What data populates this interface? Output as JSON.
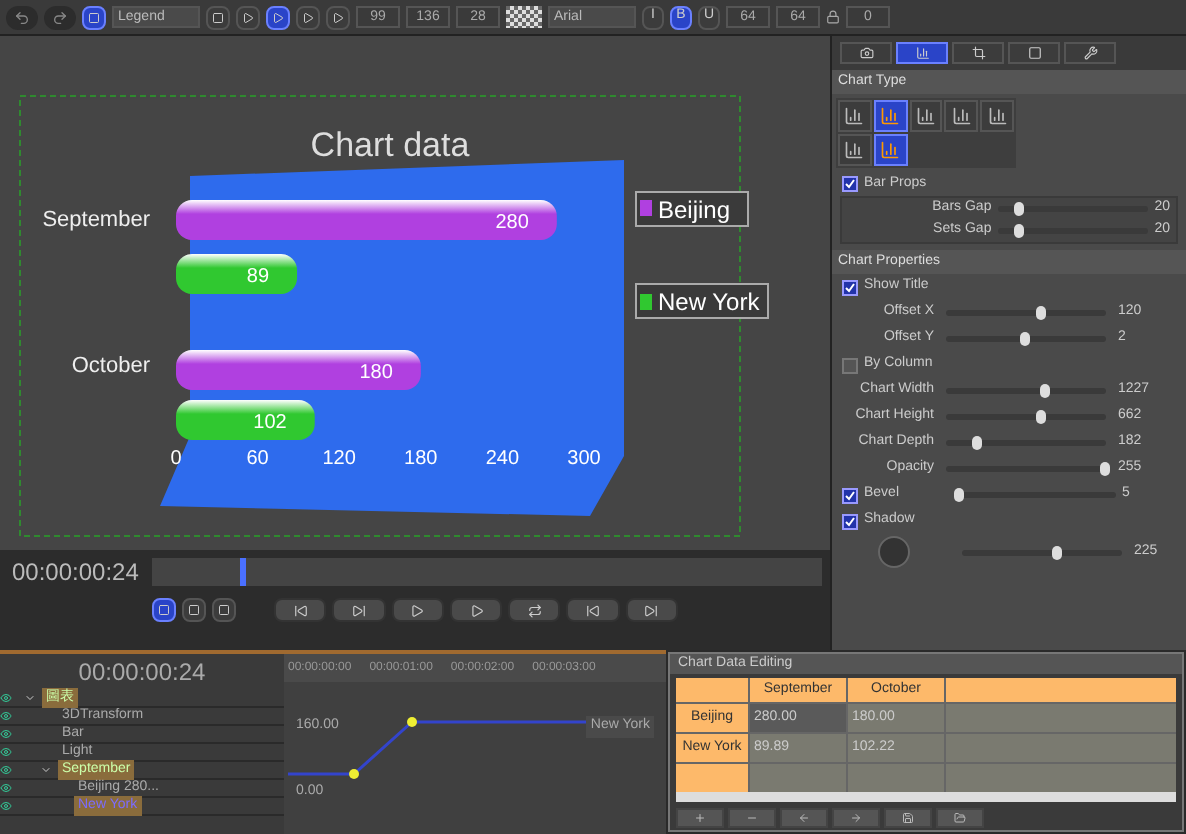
{
  "toolbar": {
    "legend_select": "Legend",
    "align_buttons": [
      {
        "selected": false
      },
      {
        "selected": true
      },
      {
        "selected": false
      },
      {
        "selected": false
      }
    ],
    "fields": [
      "99",
      "136",
      "28"
    ],
    "font_select": "Arial",
    "style_buttons": [
      {
        "label": "I",
        "selected": false
      },
      {
        "label": "B",
        "selected": true
      },
      {
        "label": "U",
        "selected": false
      }
    ],
    "size_fields": [
      "64",
      "64"
    ],
    "spacing_field": "0"
  },
  "canvas": {
    "chart_data": {
      "type": "bar",
      "orientation": "horizontal",
      "title": "Chart data",
      "categories": [
        "September",
        "October"
      ],
      "series": [
        {
          "name": "Beijing",
          "color": "#b040e0",
          "values": [
            280,
            180
          ]
        },
        {
          "name": "New York",
          "color": "#30c830",
          "values": [
            89,
            102
          ]
        }
      ],
      "xlim": [
        0,
        300
      ],
      "xticks": [
        0,
        60,
        120,
        180,
        240,
        300
      ],
      "data_labels": true,
      "legend": "right"
    }
  },
  "playback": {
    "time": "00:00:00:24",
    "level": 0.13,
    "view_buttons": [
      {
        "selected": true
      },
      {
        "selected": false
      },
      {
        "selected": false
      }
    ]
  },
  "panel": {
    "tabs": [
      {
        "selected": false
      },
      {
        "selected": true
      },
      {
        "selected": false
      },
      {
        "selected": false
      },
      {
        "selected": false
      }
    ],
    "chart_type": {
      "title": "Chart Type",
      "types": [
        {
          "selected": false
        },
        {
          "selected": true
        },
        {
          "selected": false
        },
        {
          "selected": false
        },
        {
          "selected": false
        },
        {
          "selected": false
        },
        {
          "selected": true
        }
      ]
    },
    "bar_props": {
      "label": "Bar Props",
      "checked": true,
      "sliders": [
        {
          "label": "Bars Gap",
          "value": "20",
          "level": 0.15
        },
        {
          "label": "Sets Gap",
          "value": "20",
          "level": 0.15
        }
      ]
    },
    "chart_properties": {
      "title": "Chart Properties",
      "rows": [
        {
          "kind": "check",
          "label": "Show Title",
          "checked": true
        },
        {
          "kind": "slider",
          "label": "Offset X",
          "value": "120",
          "level": 0.6
        },
        {
          "kind": "slider",
          "label": "Offset Y",
          "value": "2",
          "level": 0.5
        },
        {
          "kind": "check",
          "label": "By Column",
          "checked": false
        },
        {
          "kind": "slider",
          "label": "Chart Width",
          "value": "1227",
          "level": 0.63
        },
        {
          "kind": "slider",
          "label": "Chart Height",
          "value": "662",
          "level": 0.6
        },
        {
          "kind": "slider",
          "label": "Chart Depth",
          "value": "182",
          "level": 0.2
        },
        {
          "kind": "slider",
          "label": "Opacity",
          "value": "255",
          "level": 1.0
        },
        {
          "kind": "checkslider",
          "label": "Bevel",
          "checked": true,
          "value": "5",
          "level": 0.02
        },
        {
          "kind": "check",
          "label": "Shadow",
          "checked": true
        },
        {
          "kind": "dial",
          "value": "225",
          "level": 0.6
        }
      ]
    }
  },
  "timeline": {
    "time": "00:00:00:24",
    "tracks": [
      {
        "label": "圖表",
        "expanded": true,
        "children": [
          {
            "label": "3DTransform",
            "expanded": false
          },
          {
            "label": "Bar",
            "expanded": false
          },
          {
            "label": "Light",
            "expanded": false
          },
          {
            "label": "September",
            "expanded": true,
            "children": [
              {
                "label": "Beijing 280...",
                "selected": false
              },
              {
                "label": "New York",
                "selected": true
              }
            ]
          }
        ]
      }
    ],
    "ruler": [
      "00:00:00:00",
      "00:00:01:00",
      "00:00:02:00",
      "00:00:03:00"
    ],
    "graph_labels": [
      "160.00",
      "0.00",
      "New York"
    ]
  },
  "dialog": {
    "title": "Chart Data Editing",
    "columns": [
      "September",
      "October"
    ],
    "rows": [
      {
        "name": "Beijing",
        "cells": [
          {
            "value": "280.00",
            "selected": true
          },
          {
            "value": "180.00",
            "selected": false
          }
        ]
      },
      {
        "name": "New York",
        "cells": [
          {
            "value": "89.89",
            "selected": false
          },
          {
            "value": "102.22",
            "selected": false
          }
        ]
      }
    ]
  }
}
